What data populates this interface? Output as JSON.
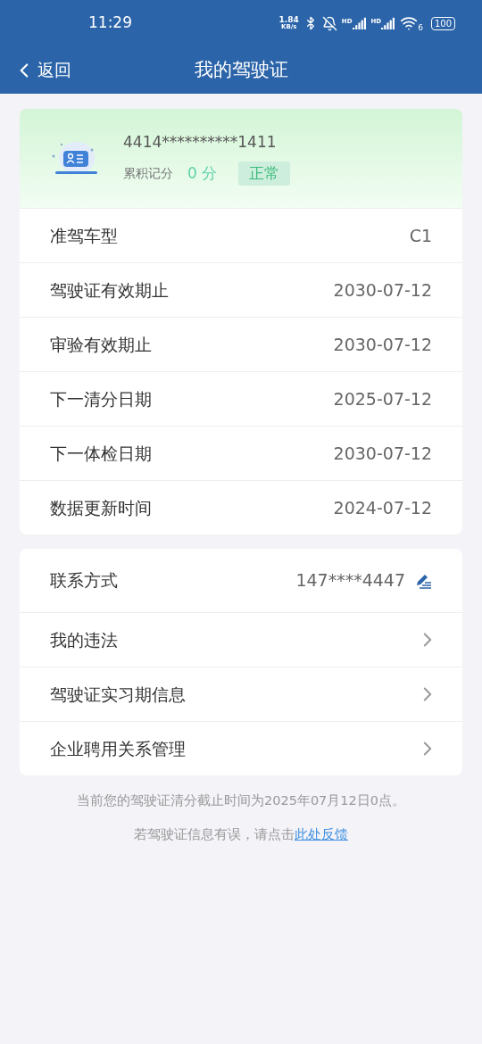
{
  "status_bar": {
    "time": "11:29",
    "speed_value": "1.84",
    "speed_unit": "KB/s",
    "signal_1": "HD",
    "signal_2": "HD",
    "wifi_badge": "6",
    "battery": "100"
  },
  "nav": {
    "back": "返回",
    "title": "我的驾驶证"
  },
  "license": {
    "number": "4414**********1411",
    "points_label": "累积记分",
    "points": "0 分",
    "status": "正常",
    "rows": [
      {
        "label": "准驾车型",
        "value": "C1"
      },
      {
        "label": "驾驶证有效期止",
        "value": "2030-07-12"
      },
      {
        "label": "审验有效期止",
        "value": "2030-07-12"
      },
      {
        "label": "下一清分日期",
        "value": "2025-07-12"
      },
      {
        "label": "下一体检日期",
        "value": "2030-07-12"
      },
      {
        "label": "数据更新时间",
        "value": "2024-07-12"
      }
    ]
  },
  "menu": [
    {
      "kind": "contact",
      "label": "联系方式",
      "value": "147****4447"
    },
    {
      "kind": "link",
      "label": "我的违法"
    },
    {
      "kind": "link",
      "label": "驾驶证实习期信息"
    },
    {
      "kind": "link",
      "label": "企业聘用关系管理"
    }
  ],
  "notice": "当前您的驾驶证清分截止时间为2025年07月12日0点。",
  "feedback": {
    "text": "若驾驶证信息有误，请点击",
    "link": "此处反馈"
  }
}
